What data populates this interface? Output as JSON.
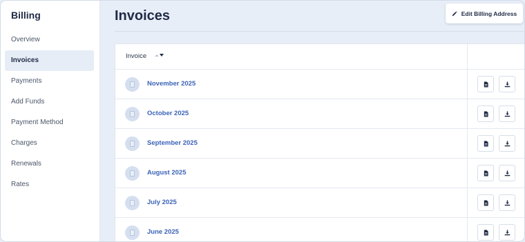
{
  "sidebar": {
    "title": "Billing",
    "items": [
      {
        "label": "Overview",
        "active": false
      },
      {
        "label": "Invoices",
        "active": true
      },
      {
        "label": "Payments",
        "active": false
      },
      {
        "label": "Add Funds",
        "active": false
      },
      {
        "label": "Payment Method",
        "active": false
      },
      {
        "label": "Charges",
        "active": false
      },
      {
        "label": "Renewals",
        "active": false
      },
      {
        "label": "Rates",
        "active": false
      }
    ]
  },
  "header": {
    "title": "Invoices",
    "edit_button_label": "Edit Billing Address"
  },
  "table": {
    "column_header": "Invoice",
    "rows": [
      {
        "invoice": "November 2025"
      },
      {
        "invoice": "October 2025"
      },
      {
        "invoice": "September 2025"
      },
      {
        "invoice": "August 2025"
      },
      {
        "invoice": "July 2025"
      },
      {
        "invoice": "June 2025"
      }
    ]
  },
  "icons": {
    "edit": "pencil-icon",
    "view": "document-icon",
    "download": "download-icon",
    "row": "invoice-document-icon",
    "sort": "sort-icon"
  },
  "colors": {
    "accent_link": "#3b63b7",
    "text_dark": "#1f2a44",
    "page_bg": "#e7eef8",
    "active_nav_bg": "#e6edf7"
  }
}
